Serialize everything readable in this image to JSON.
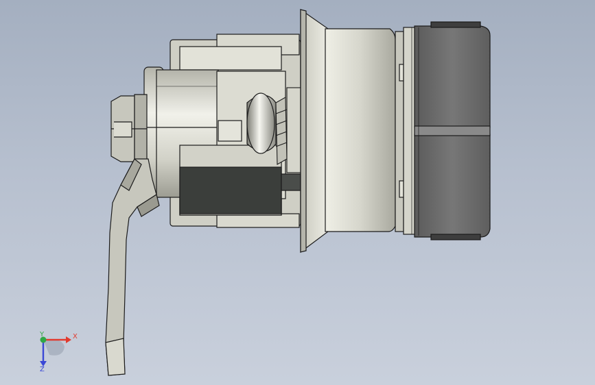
{
  "viewport": {
    "background_top": "#a4afc0",
    "background_bottom": "#c9d0dc"
  },
  "model": {
    "part_color_light": "#d4d4c9",
    "part_color_mid": "#b9b9ad",
    "part_color_dark": "#3a3d3a",
    "connector_color": "#6e6e6e",
    "edge_color": "#1b1b1b"
  },
  "triad": {
    "x_label": "X",
    "y_label": "Y",
    "z_label": "Z",
    "x_color": "#e23a2e",
    "y_color": "#2fa845",
    "z_color": "#3a48d6"
  }
}
